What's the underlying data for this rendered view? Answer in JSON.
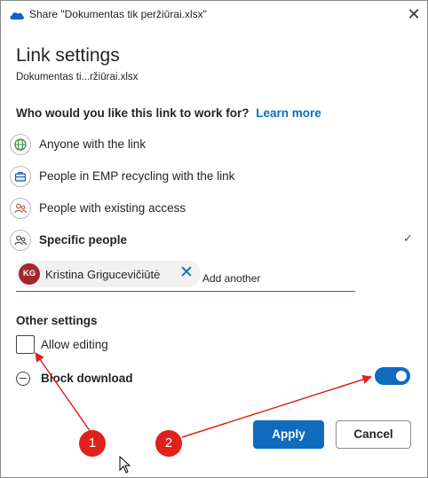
{
  "window": {
    "title": "Share \"Dokumentas tik peržiūrai.xlsx\"",
    "close_icon": "close-icon"
  },
  "header": {
    "heading": "Link settings",
    "file_name": "Dokumentas ti...ržiūrai.xlsx"
  },
  "question": {
    "text": "Who would you like this link to work for?",
    "learn_more": "Learn more"
  },
  "options": [
    {
      "label": "Anyone with the link",
      "icon": "globe-icon",
      "selected": false
    },
    {
      "label": "People in EMP recycling with the link",
      "icon": "briefcase-icon",
      "selected": false
    },
    {
      "label": "People with existing access",
      "icon": "people-icon",
      "selected": false
    },
    {
      "label": "Specific people",
      "icon": "people-icon",
      "selected": true
    }
  ],
  "recipients": {
    "chip": {
      "initials": "KG",
      "name": "Kristina Grigucevičiūtė",
      "avatar_color": "#a4262c"
    },
    "input_placeholder": "Add another"
  },
  "other_settings": {
    "heading": "Other settings",
    "allow_editing": {
      "label": "Allow editing",
      "checked": false
    },
    "block_download": {
      "label": "Block download",
      "enabled": true
    }
  },
  "footer": {
    "apply_label": "Apply",
    "cancel_label": "Cancel"
  },
  "annotations": [
    {
      "number": "1"
    },
    {
      "number": "2"
    }
  ],
  "colors": {
    "accent": "#0f6cbd",
    "annotation": "#e0201b"
  }
}
